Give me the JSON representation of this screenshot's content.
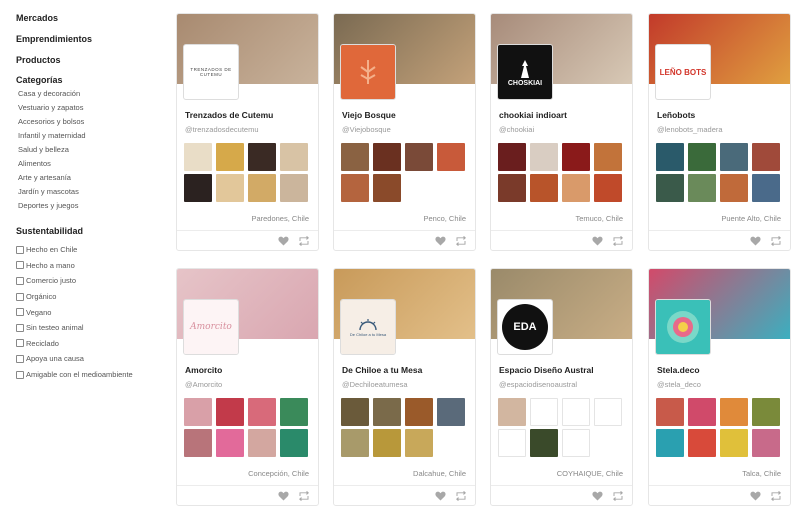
{
  "sidebar": {
    "nav": [
      "Mercados",
      "Emprendimientos",
      "Productos"
    ],
    "categories_title": "Categorías",
    "categories": [
      "Casa y decoración",
      "Vestuario y zapatos",
      "Accesorios y bolsos",
      "Infantil y maternidad",
      "Salud y belleza",
      "Alimentos",
      "Arte y artesanía",
      "Jardín y mascotas",
      "Deportes y juegos"
    ],
    "sustainability_title": "Sustentabilidad",
    "sustainability": [
      "Hecho en Chile",
      "Hecho a mano",
      "Comercio justo",
      "Orgánico",
      "Vegano",
      "Sin testeo animal",
      "Reciclado",
      "Apoya una causa",
      "Amigable con el medioambiente"
    ]
  },
  "cards": [
    {
      "name": "Trenzados de Cutemu",
      "handle": "@trenzadosdecutemu",
      "location": "Paredones, Chile",
      "logo_text": "TRENZADOS DE CUTEMU",
      "logo_style": "plain",
      "cover": [
        "#a88a70",
        "#c9b39c"
      ],
      "thumbs": [
        "#e9ddc7",
        "#d6a94a",
        "#3a2a24",
        "#d8c3a5",
        "#2b2220",
        "#e2c79a",
        "#d2aa66",
        "#cbb59c"
      ]
    },
    {
      "name": "Viejo Bosque",
      "handle": "@Viejobosque",
      "location": "Penco, Chile",
      "logo_text": "",
      "logo_style": "orange",
      "cover": [
        "#7a6a52",
        "#c4a27a"
      ],
      "thumbs": [
        "#8a6242",
        "#6a3020",
        "#7a4a38",
        "#c85a3a",
        "#b4643e",
        "#8a4a2a"
      ]
    },
    {
      "name": "chookiai indioart",
      "handle": "@chookiai",
      "location": "Temuco, Chile",
      "logo_text": "CHOSKIAI",
      "logo_style": "black",
      "cover": [
        "#a78b7a",
        "#d8c9b6"
      ],
      "thumbs": [
        "#6a1e1e",
        "#d9cdc2",
        "#8a1a1a",
        "#c2733a",
        "#7a3a2a",
        "#b8542a",
        "#d99a6a",
        "#c04a2a"
      ]
    },
    {
      "name": "Leñobots",
      "handle": "@lenobots_madera",
      "location": "Puente Alto, Chile",
      "logo_text": "LEÑO BOTS",
      "logo_style": "leno",
      "cover": [
        "#c23a2a",
        "#e0a040"
      ],
      "thumbs": [
        "#2a5a6a",
        "#3a6a3a",
        "#4a6a7a",
        "#a04a3a",
        "#3a5a4a",
        "#6a8a5a",
        "#c06a3a",
        "#4a6a8a"
      ]
    },
    {
      "name": "Amorcito",
      "handle": "@Amorcito",
      "location": "Concepción, Chile",
      "logo_text": "Amorcito",
      "logo_style": "amorcito",
      "cover": [
        "#e6c4c8",
        "#d9a6b0"
      ],
      "thumbs": [
        "#d9a0a8",
        "#c23a4a",
        "#d86a7a",
        "#3a8a5a",
        "#b8747a",
        "#e26a9a",
        "#d3a7a0",
        "#2a8a6a"
      ]
    },
    {
      "name": "De Chiloe a tu Mesa",
      "handle": "@Dechiloeatumesa",
      "location": "Dalcahue, Chile",
      "logo_text": "De Chiloe a tu Mesa",
      "logo_style": "chiloe",
      "cover": [
        "#c89a5a",
        "#e3c08a"
      ],
      "thumbs": [
        "#6a5a3a",
        "#7a6a4a",
        "#9a5a2a",
        "#5a6a7a",
        "#a89a6a",
        "#b8983a",
        "#c8a85a"
      ]
    },
    {
      "name": "Espacio Diseño Austral",
      "handle": "@espaciodisenoaustral",
      "location": "COYHAIQUE, Chile",
      "logo_text": "EDA",
      "logo_style": "eda",
      "cover": [
        "#9a8a6a",
        "#c9ae86"
      ],
      "thumbs": [
        "#d2b6a0",
        "#ffffff",
        "#ffffff",
        "#ffffff",
        "#ffffff",
        "#3a4a2a",
        "#ffffff"
      ]
    },
    {
      "name": "Stela.deco",
      "handle": "@stela_deco",
      "location": "Talca, Chile",
      "logo_text": "",
      "logo_style": "stela",
      "cover": [
        "#d24a6a",
        "#3ab0c0"
      ],
      "thumbs": [
        "#c85a4a",
        "#d04a6a",
        "#e08a3a",
        "#7a8a3a",
        "#2aa0b0",
        "#d84a3a",
        "#e0c03a",
        "#c86a8a"
      ]
    }
  ],
  "icons": {
    "like": "heart-icon",
    "share": "repost-icon"
  }
}
